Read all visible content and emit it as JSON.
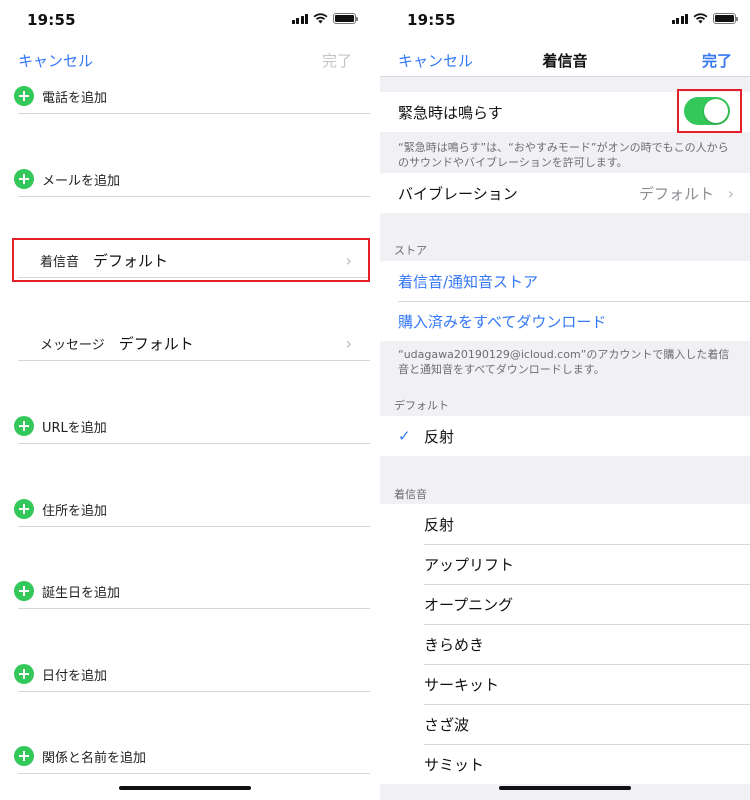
{
  "status_bar": {
    "time": "19:55"
  },
  "left": {
    "nav": {
      "cancel": "キャンセル",
      "done": "完了"
    },
    "rows": [
      {
        "label": "電話を追加"
      },
      {
        "label": "メールを追加"
      },
      {
        "label": "着信音",
        "value": "デフォルト"
      },
      {
        "label": "メッセージ",
        "value": "デフォルト"
      },
      {
        "label": "URLを追加"
      },
      {
        "label": "住所を追加"
      },
      {
        "label": "誕生日を追加"
      },
      {
        "label": "日付を追加"
      },
      {
        "label": "関係と名前を追加"
      }
    ]
  },
  "right": {
    "nav": {
      "cancel": "キャンセル",
      "title": "着信音",
      "done": "完了"
    },
    "emergency": {
      "label": "緊急時は鳴らす",
      "toggle_on": true
    },
    "emergency_note": "“緊急時は鳴らす”は、“おやすみモード”がオンの時でもこの人からのサウンドやバイブレーションを許可します。",
    "vibration": {
      "label": "バイブレーション",
      "value": "デフォルト"
    },
    "store_header": "ストア",
    "store_items": [
      "着信音/通知音ストア",
      "購入済みをすべてダウンロード"
    ],
    "store_note": "“udagawa20190129@icloud.com”のアカウントで購入した着信音と通知音をすべてダウンロードします。",
    "default_header": "デフォルト",
    "default_item": "反射",
    "ringtones_header": "着信音",
    "ringtones": [
      "反射",
      "アップリフト",
      "オープニング",
      "きらめき",
      "サーキット",
      "さざ波",
      "サミット"
    ]
  },
  "colors": {
    "accent": "#3478f6",
    "toggle_on": "#34c759",
    "highlight": "#e3202a"
  }
}
